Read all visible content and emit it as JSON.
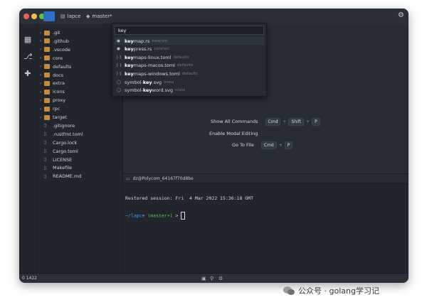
{
  "titlebar": {
    "folder": "lapce",
    "branch": "master*"
  },
  "explorer": {
    "items": [
      {
        "label": ".git",
        "type": "folder"
      },
      {
        "label": ".github",
        "type": "folder"
      },
      {
        "label": ".vscode",
        "type": "folder"
      },
      {
        "label": "core",
        "type": "folder"
      },
      {
        "label": "defaults",
        "type": "folder"
      },
      {
        "label": "docs",
        "type": "folder"
      },
      {
        "label": "extra",
        "type": "folder"
      },
      {
        "label": "icons",
        "type": "folder"
      },
      {
        "label": "proxy",
        "type": "folder"
      },
      {
        "label": "rpc",
        "type": "folder"
      },
      {
        "label": "target",
        "type": "folder"
      },
      {
        "label": ".gitignore",
        "type": "file"
      },
      {
        "label": ".rustfmt.toml",
        "type": "file"
      },
      {
        "label": "Cargo.lock",
        "type": "file"
      },
      {
        "label": "Cargo.toml",
        "type": "file"
      },
      {
        "label": "LICENSE",
        "type": "file"
      },
      {
        "label": "Makefile",
        "type": "file"
      },
      {
        "label": "README.md",
        "type": "file"
      }
    ]
  },
  "palette": {
    "query": "key",
    "items": [
      {
        "match": "key",
        "rest": "map.rs",
        "dir": "core/src",
        "selected": true
      },
      {
        "match": "key",
        "rest": "press.rs",
        "dir": "core/src",
        "selected": false
      },
      {
        "match": "key",
        "rest": "maps-linux.toml",
        "dir": "defaults",
        "selected": false
      },
      {
        "match": "key",
        "rest": "maps-macos.toml",
        "dir": "defaults",
        "selected": false
      },
      {
        "match": "key",
        "rest": "maps-windows.toml",
        "dir": "defaults",
        "selected": false
      },
      {
        "pre": "symbol-",
        "match": "key",
        "rest": ".svg",
        "dir": "icons",
        "selected": false
      },
      {
        "pre": "symbol-",
        "match": "key",
        "rest": "word.svg",
        "dir": "icons",
        "selected": false
      }
    ]
  },
  "shortcuts": {
    "show_all_label": "Show All Commands",
    "show_all_keys": [
      "Cmd",
      "Shift",
      "P"
    ],
    "modal_label": "Enable Modal Editing",
    "goto_label": "Go To File",
    "goto_keys": [
      "Cmd",
      "P"
    ]
  },
  "terminal": {
    "tab_title": "dz@Polycom_64167f70d8be",
    "restored": "Restored session: Fri  4 Mar 2022 15:36:18 GMT",
    "prompt_path": "~/lapce",
    "prompt_branch": "(master+)",
    "prompt_symbol": ">"
  },
  "statusbar": {
    "left": "0  1422"
  },
  "watermark": {
    "text": "公众号 · golang学习记"
  },
  "colors": {
    "accent": "#2f6fc8",
    "folder": "#c08a3a",
    "prompt_path": "#5b9bd5",
    "prompt_branch": "#6bbf59"
  }
}
